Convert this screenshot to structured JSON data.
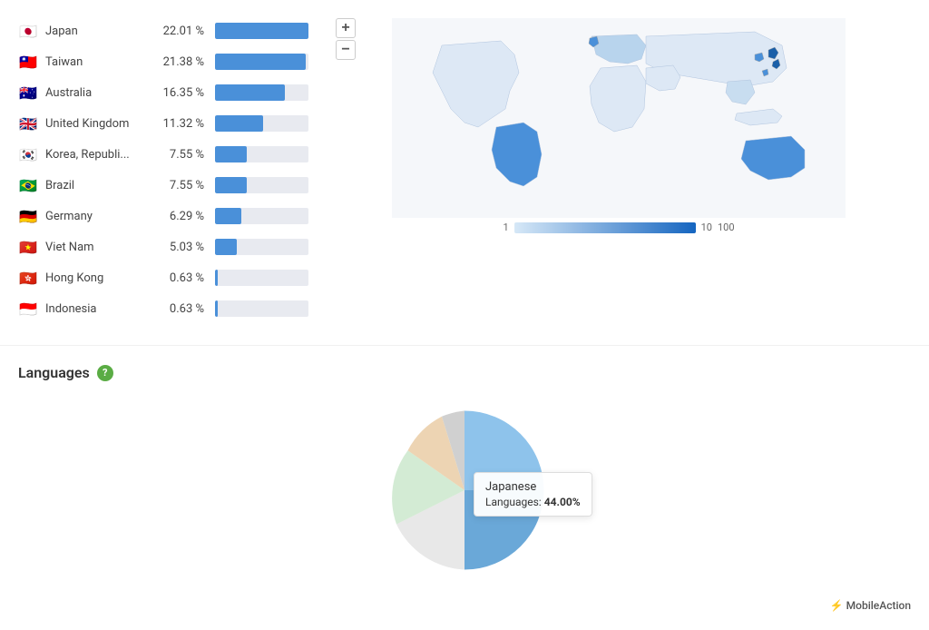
{
  "countries": [
    {
      "name": "Japan",
      "pct": "22.01 %",
      "pct_num": 22.01,
      "flag": "🇯🇵"
    },
    {
      "name": "Taiwan",
      "pct": "21.38 %",
      "pct_num": 21.38,
      "flag": "🇹🇼"
    },
    {
      "name": "Australia",
      "pct": "16.35 %",
      "pct_num": 16.35,
      "flag": "🇦🇺"
    },
    {
      "name": "United Kingdom",
      "pct": "11.32 %",
      "pct_num": 11.32,
      "flag": "🇬🇧"
    },
    {
      "name": "Korea, Republi...",
      "pct": "7.55 %",
      "pct_num": 7.55,
      "flag": "🇰🇷"
    },
    {
      "name": "Brazil",
      "pct": "7.55 %",
      "pct_num": 7.55,
      "flag": "🇧🇷"
    },
    {
      "name": "Germany",
      "pct": "6.29 %",
      "pct_num": 6.29,
      "flag": "🇩🇪"
    },
    {
      "name": "Viet Nam",
      "pct": "5.03 %",
      "pct_num": 5.03,
      "flag": "🇻🇳"
    },
    {
      "name": "Hong Kong",
      "pct": "0.63 %",
      "pct_num": 0.63,
      "flag": "🇭🇰"
    },
    {
      "name": "Indonesia",
      "pct": "0.63 %",
      "pct_num": 0.63,
      "flag": "🇮🇩"
    }
  ],
  "map_controls": {
    "zoom_in": "+",
    "zoom_out": "−"
  },
  "legend": {
    "min": "1",
    "mid": "10",
    "max": "100"
  },
  "languages_section": {
    "title": "Languages",
    "help_icon": "?"
  },
  "tooltip": {
    "title": "Japanese",
    "label": "Languages:",
    "value": "44.00%"
  },
  "branding": {
    "icon": "⚡",
    "name": "MobileAction"
  }
}
